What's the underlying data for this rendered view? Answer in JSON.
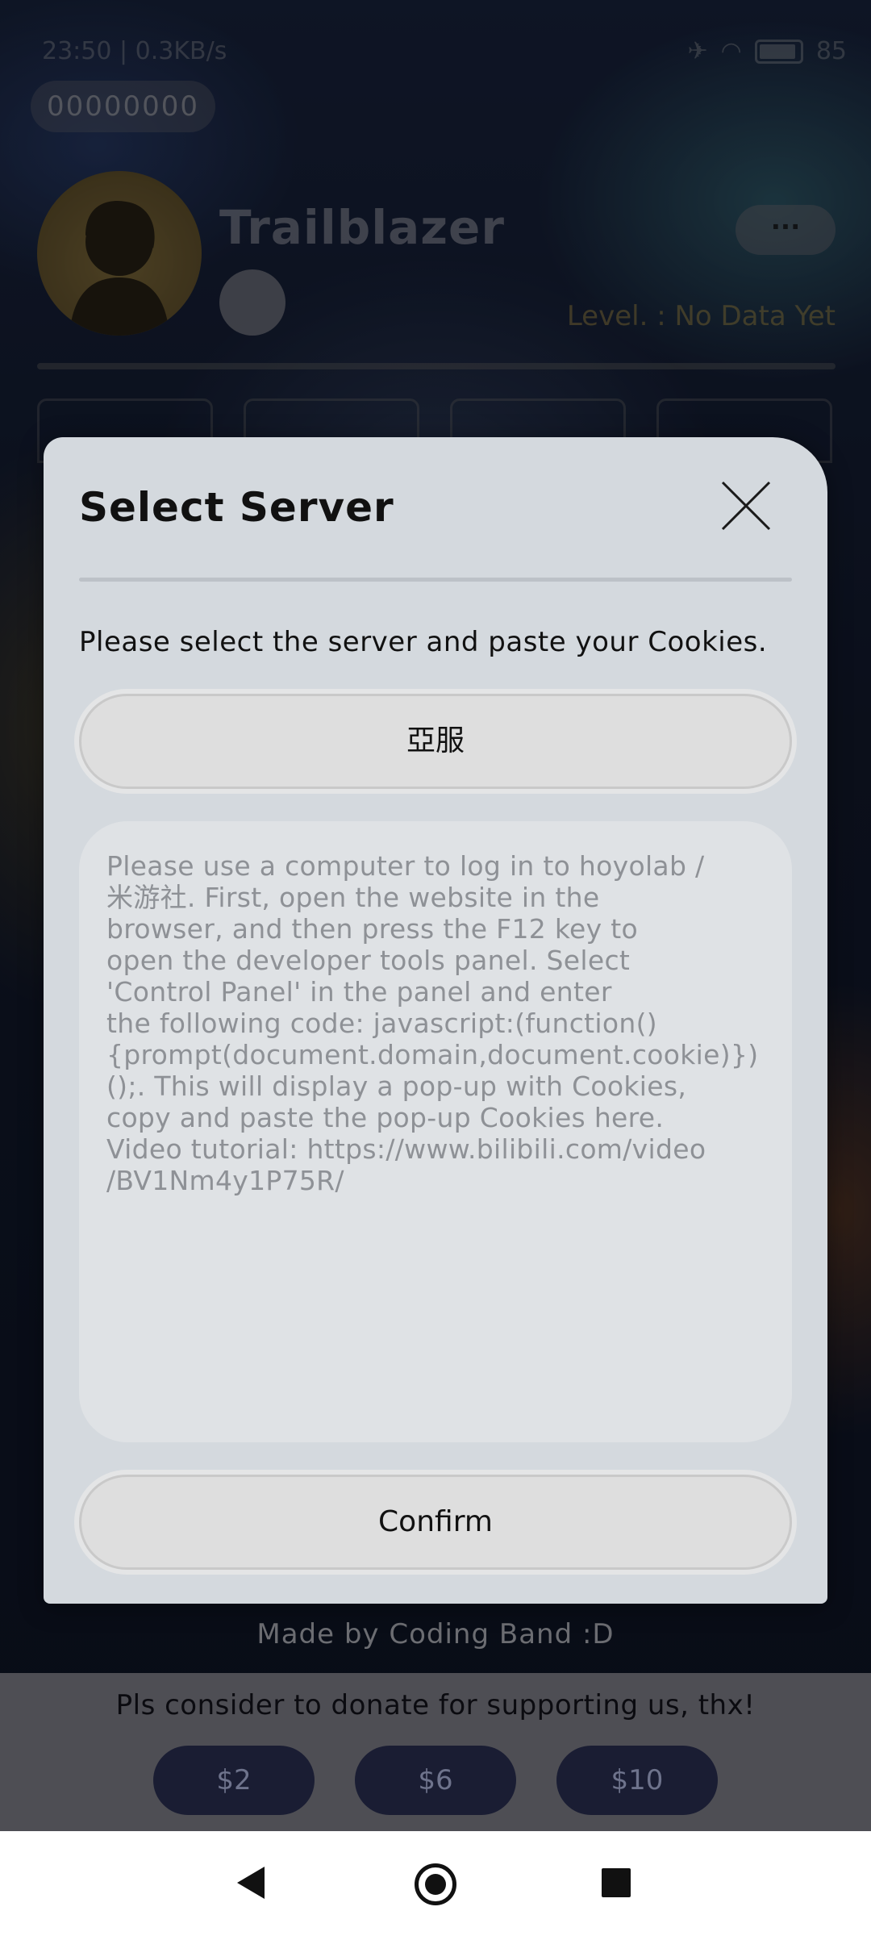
{
  "status_bar": {
    "time": "23:50",
    "net_speed": "0.3KB/s",
    "battery": "85"
  },
  "profile": {
    "uid": "00000000",
    "name": "Trailblazer",
    "level": "Level. : No Data Yet",
    "more_label": "···"
  },
  "footer": {
    "credit": "Made by Coding Band :D",
    "donate_message": "Pls consider to donate for supporting us, thx!",
    "donate_options": [
      "$2",
      "$6",
      "$10"
    ]
  },
  "dialog": {
    "title": "Select Server",
    "instruction": "Please select the server and paste your Cookies.",
    "server_selected": "亞服",
    "cookie_placeholder": "Please use a computer to log in to hoyolab /\n米游社. First, open the website in the\nbrowser, and then press the F12 key to\nopen the developer tools panel. Select\n'Control Panel' in the panel and enter\nthe following code: javascript:(function()\n{prompt(document.domain,document.cookie)})\n();. This will display a pop-up with Cookies,\ncopy and paste the pop-up Cookies here.\nVideo tutorial: https://www.bilibili.com/video\n/BV1Nm4y1P75R/",
    "confirm_label": "Confirm"
  },
  "colors": {
    "dialog_bg": "#d4d9de",
    "button_bg": "#dedede",
    "donate_btn_bg": "#1a1d33",
    "level_text": "#c9a24b"
  },
  "icons": [
    "close-icon",
    "wifi-icon",
    "airplane-icon",
    "battery-icon",
    "back-icon",
    "home-icon",
    "recent-apps-icon"
  ]
}
